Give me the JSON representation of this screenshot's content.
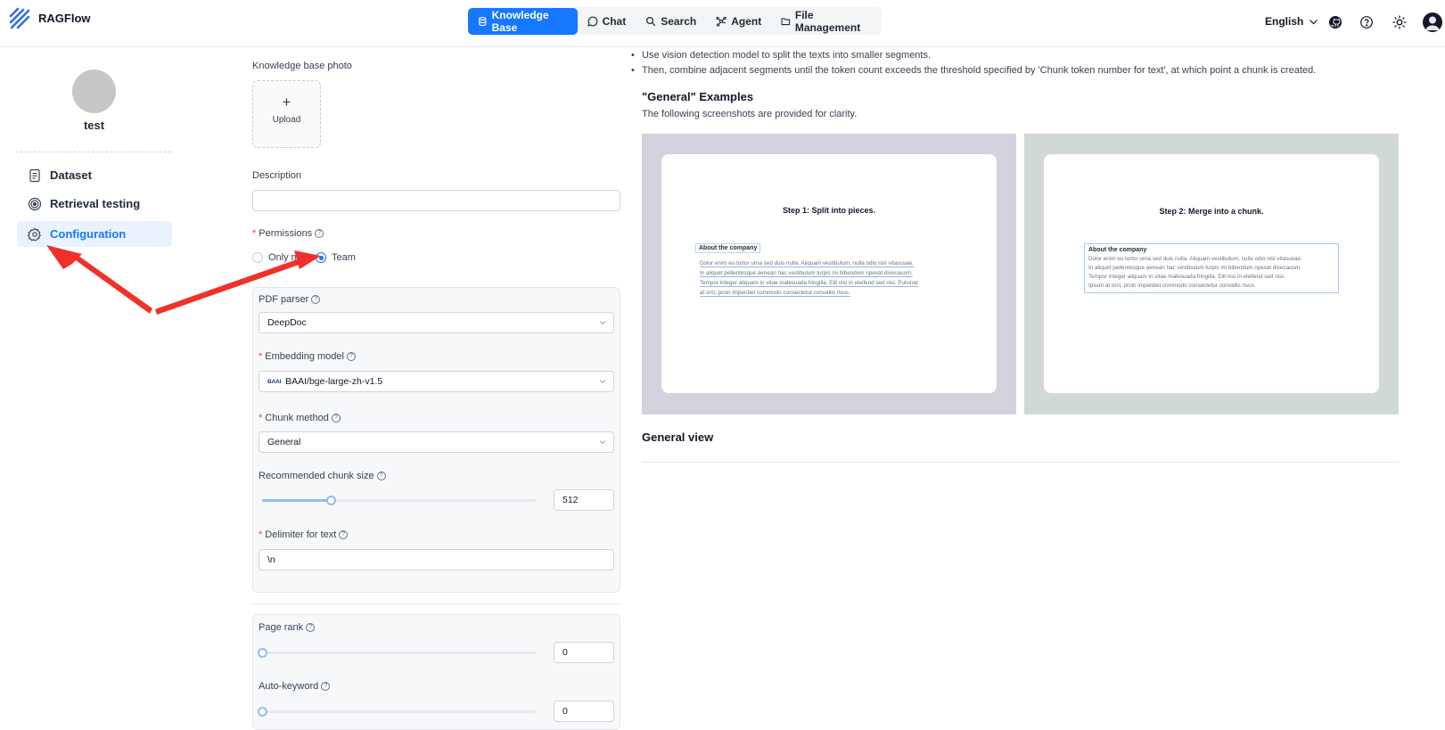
{
  "app": {
    "name": "RAGFlow"
  },
  "nav": {
    "items": [
      {
        "label": "Knowledge Base",
        "icon": "database-icon",
        "active": true
      },
      {
        "label": "Chat",
        "icon": "chat-bubble-icon",
        "active": false
      },
      {
        "label": "Search",
        "icon": "search-icon",
        "active": false
      },
      {
        "label": "Agent",
        "icon": "agent-graph-icon",
        "active": false
      },
      {
        "label": "File Management",
        "icon": "folder-icon",
        "active": false
      }
    ]
  },
  "header_right": {
    "language": "English",
    "icons": [
      "github-icon",
      "help-icon",
      "theme-sun-icon",
      "user-avatar"
    ]
  },
  "sidebar": {
    "kb_name": "test",
    "items": [
      {
        "label": "Dataset",
        "icon": "document-icon",
        "active": false
      },
      {
        "label": "Retrieval testing",
        "icon": "target-icon",
        "active": false
      },
      {
        "label": "Configuration",
        "icon": "gear-icon",
        "active": true
      }
    ]
  },
  "form": {
    "photo_label": "Knowledge base photo",
    "upload_plus": "+",
    "upload_label": "Upload",
    "description_label": "Description",
    "description_value": "",
    "permissions_label": "Permissions",
    "permissions_options": [
      "Only me",
      "Team"
    ],
    "permissions_selected": "Team",
    "pdf_parser_label": "PDF parser",
    "pdf_parser_value": "DeepDoc",
    "embedding_label": "Embedding model",
    "embedding_value": "BAAI/bge-large-zh-v1.5",
    "embedding_logo_text": "BAAI",
    "chunk_method_label": "Chunk method",
    "chunk_method_value": "General",
    "chunk_size_label": "Recommended chunk size",
    "chunk_size_value": "512",
    "chunk_size_fraction": 0.25,
    "delimiter_label": "Delimiter for text",
    "delimiter_value": "\\n",
    "page_rank_label": "Page rank",
    "page_rank_value": "0",
    "auto_keyword_label": "Auto-keyword",
    "auto_keyword_value": "0"
  },
  "info": {
    "bullets": [
      "Use vision detection model to split the texts into smaller segments.",
      "Then, combine adjacent segments until the token count exceeds the threshold specified by 'Chunk token number for text', at which point a chunk is created."
    ],
    "examples_title": "\"General\" Examples",
    "examples_sub": "The following screenshots are provided for clarity.",
    "shot1": {
      "step": "Step 1: Split into pieces.",
      "heading": "About the company",
      "lines": [
        "Dolor enim eu tortor urna sed duis nulla. Aliquam vestibulum, nulla odio nisl vitasusae.",
        "In aliquet pellentesque aenean hac vestibulum turpis mi bibendum npexat dixecausm.",
        "Tempor integer aliquam in vitae malesuada fringilla. Elit nisi in eleifend sed nisi. Pulvinar",
        "at orci, proin imperdiet commodo consectetur convallis risus."
      ]
    },
    "shot2": {
      "step": "Step 2: Merge into a chunk.",
      "heading": "About the company",
      "lines": [
        "Dolor enim eu tortor urna sed duis nulla. Aliquam vestibulum, nulla odio nisl vitasusae.",
        "In aliquet pellentesque aenean hac vestibulum turpis mi bibendum npexat dixecausm.",
        "Tempor integer aliquam in vitae malesuada fringilla. Elit nisi in eleifend sed nisi.",
        "Ipsum at orci, proin imperdiet commodo consectetur convallis risus."
      ]
    },
    "general_view_title": "General view"
  },
  "colors": {
    "accent": "#1677ff",
    "annotation_arrow": "#f0302a",
    "shot1_bg": "#d4d2de",
    "shot2_bg": "#d0d9d5"
  }
}
